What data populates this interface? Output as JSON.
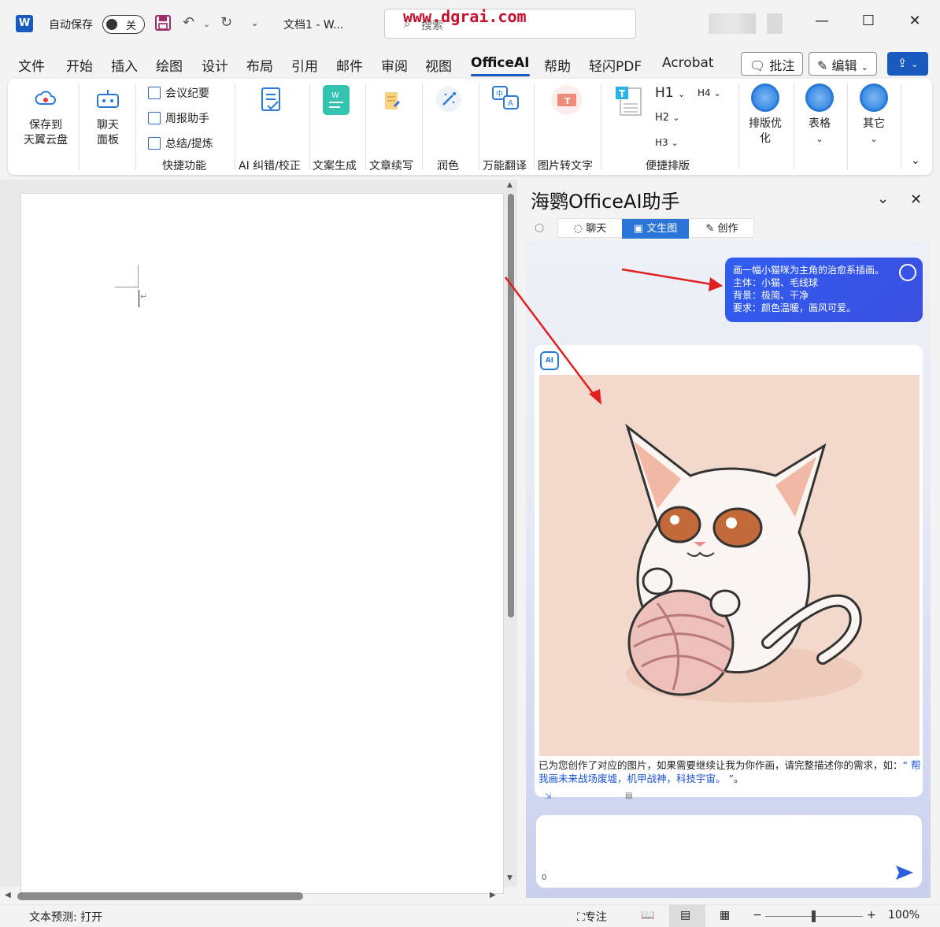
{
  "titlebar": {
    "autosave_label": "自动保存",
    "autosave_state": "关",
    "doc_title": "文档1  -  W...",
    "search_placeholder": "搜索",
    "watermark": "www.dgrai.com"
  },
  "menu": {
    "tabs": [
      "文件",
      "开始",
      "插入",
      "绘图",
      "设计",
      "布局",
      "引用",
      "邮件",
      "审阅",
      "视图",
      "OfficeAI",
      "帮助",
      "轻闪PDF",
      "Acrobat"
    ],
    "active_tab": "OfficeAI",
    "comment_button": "批注",
    "edit_button": "编辑"
  },
  "ribbon": {
    "save_cloud": "保存到\n天翼云盘",
    "chat_panel": "聊天\n面板",
    "meeting": "会议纪要",
    "weekly": "周报助手",
    "summary": "总结/提炼",
    "quick_group": "快捷功能",
    "ai_correct": "AI 纠错/校正",
    "copy_gen": "文案生成",
    "continue_write": "文章续写",
    "polish": "润色",
    "translate": "万能翻译",
    "ocr": "图片转文字",
    "h1": "H1",
    "h2": "H2",
    "h3": "H3",
    "h4": "H4",
    "layout_group": "便捷排版",
    "optimize": "排版优\n化",
    "table": "表格",
    "other": "其它"
  },
  "panel": {
    "title": "海鹦OfficeAI助手",
    "tabs": [
      "聊天",
      "文生图",
      "创作"
    ],
    "active_tab": "文生图",
    "user_message": [
      "画一幅小猫咪为主角的治愈系插画。",
      "主体：小猫、毛线球",
      "背景：极简、干净",
      "要求：颜色温暖，画风可爱。"
    ],
    "ai_badge": "AI",
    "reply_text": "已为您创作了对应的图片，如果需要继续让我为你作画，请完整描述你的需求，如：",
    "reply_example": "“ 帮我画未来战场废墟，机甲战神，科技宇宙。 ”",
    "reply_end": "。",
    "input_count": "0"
  },
  "statusbar": {
    "prediction": "文本预测: 打开",
    "focus": "专注",
    "zoom": "100%"
  }
}
